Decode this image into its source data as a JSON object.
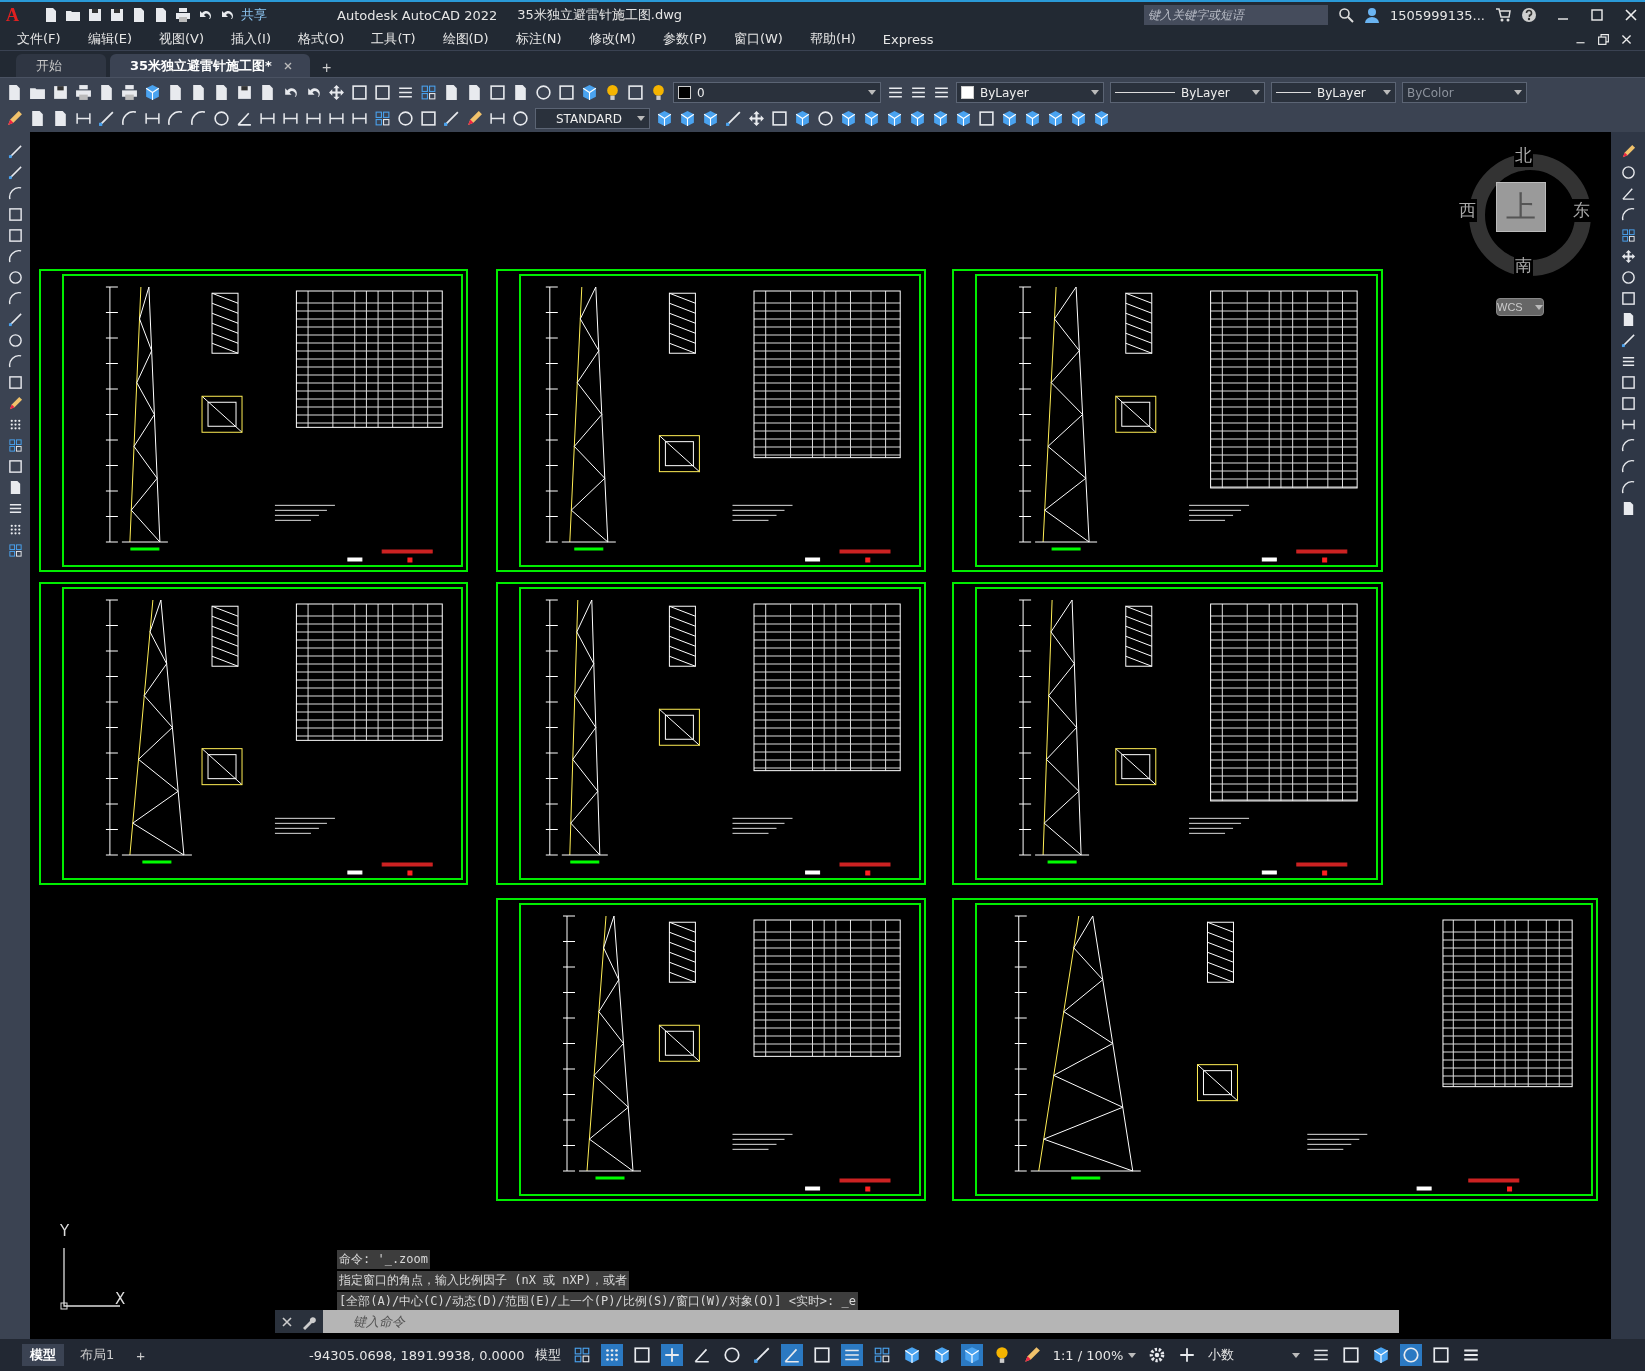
{
  "title_bar": {
    "app_logo": "A",
    "share": "共享",
    "app_title": "Autodesk AutoCAD 2022",
    "file_title": "35米独立避雷针施工图.dwg",
    "search": {
      "placeholder": "键入关键字或短语"
    },
    "user": "1505999135..."
  },
  "menu": [
    "文件(F)",
    "编辑(E)",
    "视图(V)",
    "插入(I)",
    "格式(O)",
    "工具(T)",
    "绘图(D)",
    "标注(N)",
    "修改(M)",
    "参数(P)",
    "窗口(W)",
    "帮助(H)",
    "Express"
  ],
  "doc_tabs": [
    {
      "label": "开始",
      "selected": false,
      "closable": false
    },
    {
      "label": "35米独立避雷针施工图*",
      "selected": true,
      "closable": true
    }
  ],
  "new_tab": "+",
  "properties": {
    "layer": "0",
    "color_setting": "ByLayer",
    "linetype": "ByLayer",
    "lineweight": "ByLayer",
    "plot_style": {
      "value": "ByColor",
      "disabled": true
    }
  },
  "text_style": "STANDARD",
  "viewcube": {
    "north": "北",
    "east": "东",
    "south": "南",
    "west": "西",
    "face": "上",
    "coordinate_system": "WCS"
  },
  "ucs": {
    "y": "Y",
    "x": "X"
  },
  "command_line": {
    "history": [
      "命令: '_.zoom",
      "指定窗口的角点，输入比例因子 (nX 或 nXP)，或者",
      "[全部(A)/中心(C)/动态(D)/范围(E)/上一个(P)/比例(S)/窗口(W)/对象(O)] <实时>: _e"
    ],
    "placeholder": "键入命令"
  },
  "layout_tabs": [
    {
      "label": "模型",
      "selected": true
    },
    {
      "label": "布局1",
      "selected": false
    }
  ],
  "layout_add": "+",
  "status_bar": {
    "coordinates": "-94305.0698, 1891.9938, 0.0000",
    "space": "模型",
    "scale": "1:1 / 100%",
    "units": "小数",
    "toggles": [
      {
        "on": false
      },
      {
        "on": true
      },
      {
        "on": false
      },
      {
        "on": true
      },
      {
        "on": false
      },
      {
        "on": false
      },
      {
        "on": false
      },
      {
        "on": true
      },
      {
        "on": false
      },
      {
        "on": true
      },
      {
        "on": false
      },
      {
        "on": false
      },
      {
        "on": false
      },
      {
        "on": true
      },
      {
        "on": false
      },
      {
        "on": false
      }
    ],
    "tail_toggles": [
      {
        "on": false
      },
      {
        "on": false
      },
      {
        "on": false
      },
      {
        "on": true
      },
      {
        "on": false
      }
    ]
  }
}
